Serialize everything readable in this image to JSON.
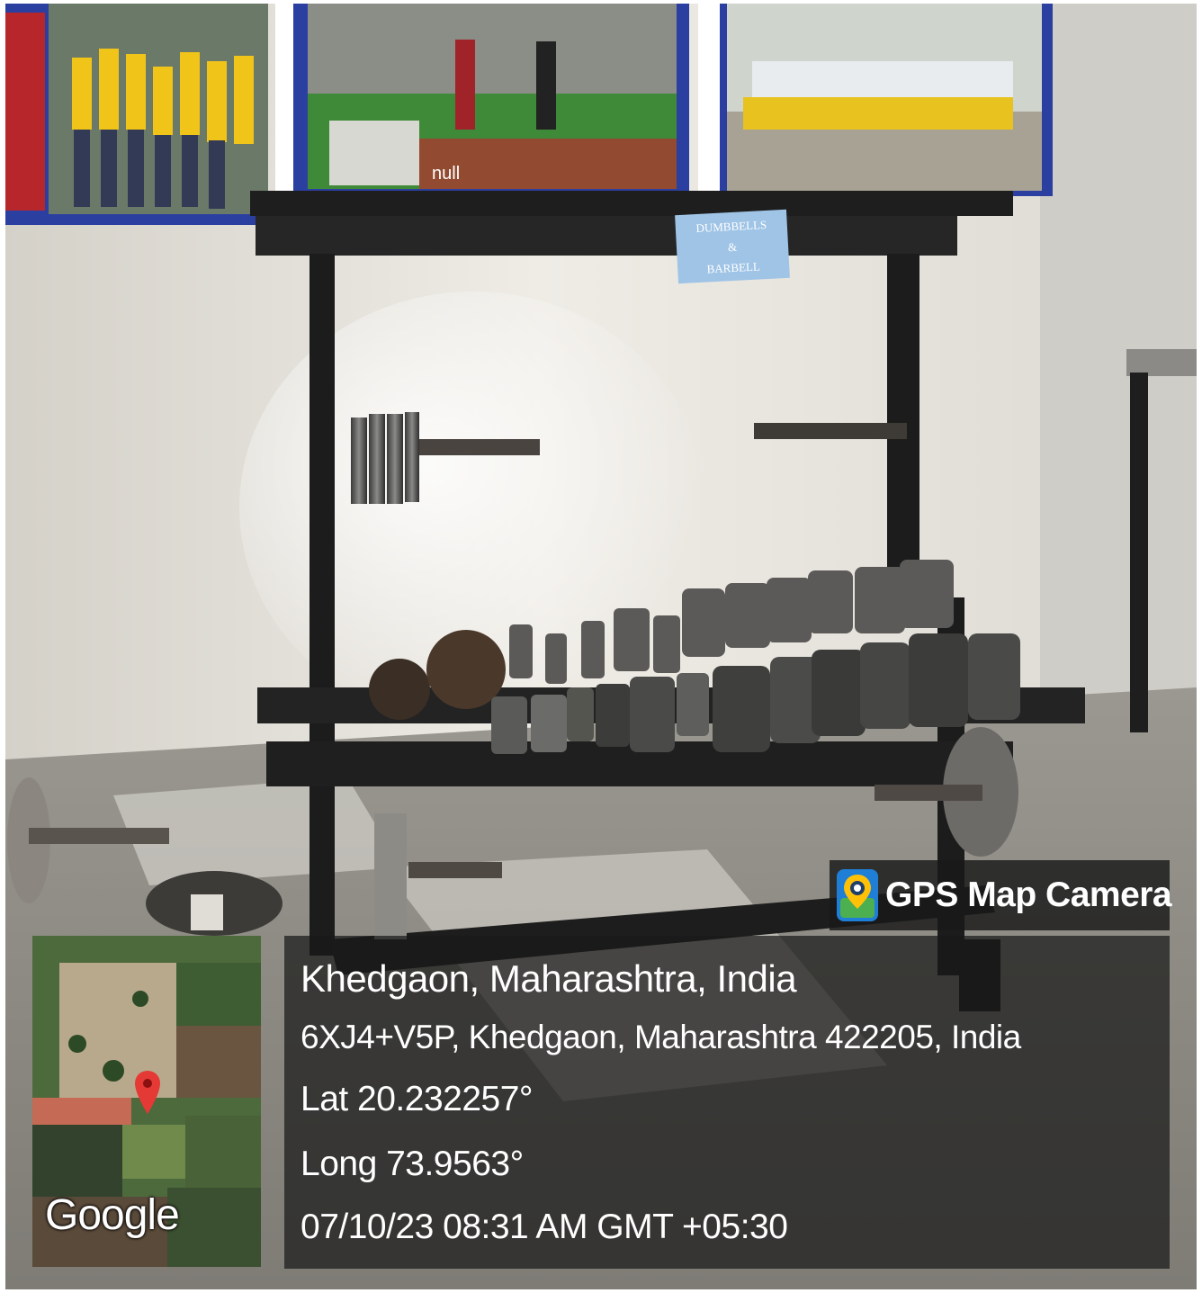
{
  "brand": {
    "name": "GPS Map Camera",
    "icon": "map-pin-camera-icon",
    "color": "#ffffff"
  },
  "location": {
    "title": "Khedgaon, Maharashtra, India",
    "address": "6XJ4+V5P, Khedgaon, Maharashtra 422205, India",
    "lat": "Lat 20.232257°",
    "long": "Long 73.9563°",
    "timestamp": "07/10/23 08:31 AM GMT +05:30"
  },
  "map": {
    "provider": "Google",
    "marker_icon": "red-location-pin-icon",
    "marker_color": "#e53935"
  },
  "scene": {
    "sign_lines": [
      "DUMBBELLS",
      "&",
      "BARBELL"
    ],
    "poster_caption": "null"
  }
}
